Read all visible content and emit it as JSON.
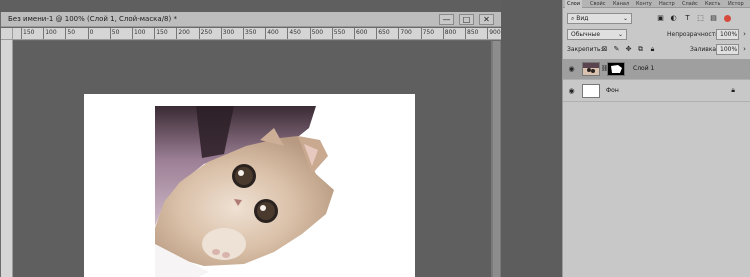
{
  "document": {
    "title": "Без имени-1 @ 100% (Слой 1, Слой-маска/8) *",
    "minimize": "—",
    "maximize": "□",
    "close": "✕",
    "ruler_labels": [
      "150",
      "100",
      "50",
      "0",
      "50",
      "100",
      "150",
      "200",
      "250",
      "300",
      "350",
      "400",
      "450",
      "500",
      "550",
      "600",
      "650",
      "700",
      "750",
      "800",
      "850",
      "900"
    ]
  },
  "panel": {
    "tabs": [
      "Слои",
      "Свойс",
      "Канал",
      "Конту",
      "Настр",
      "Слайс",
      "Кисть",
      "Истор"
    ],
    "search_kind": "Вид",
    "blend_mode": "Обычные",
    "opacity_label": "Непрозрачность:",
    "opacity_value": "100%",
    "lock_label": "Закрепить:",
    "fill_label": "Заливка:",
    "fill_value": "100%",
    "layers": [
      {
        "name": "Слой 1",
        "selected": true
      },
      {
        "name": "Фон",
        "selected": false
      }
    ],
    "icons": {
      "filter": "image-icon",
      "eye": "eye-icon",
      "lock": "lock-icon",
      "chain": "chain-icon"
    }
  }
}
